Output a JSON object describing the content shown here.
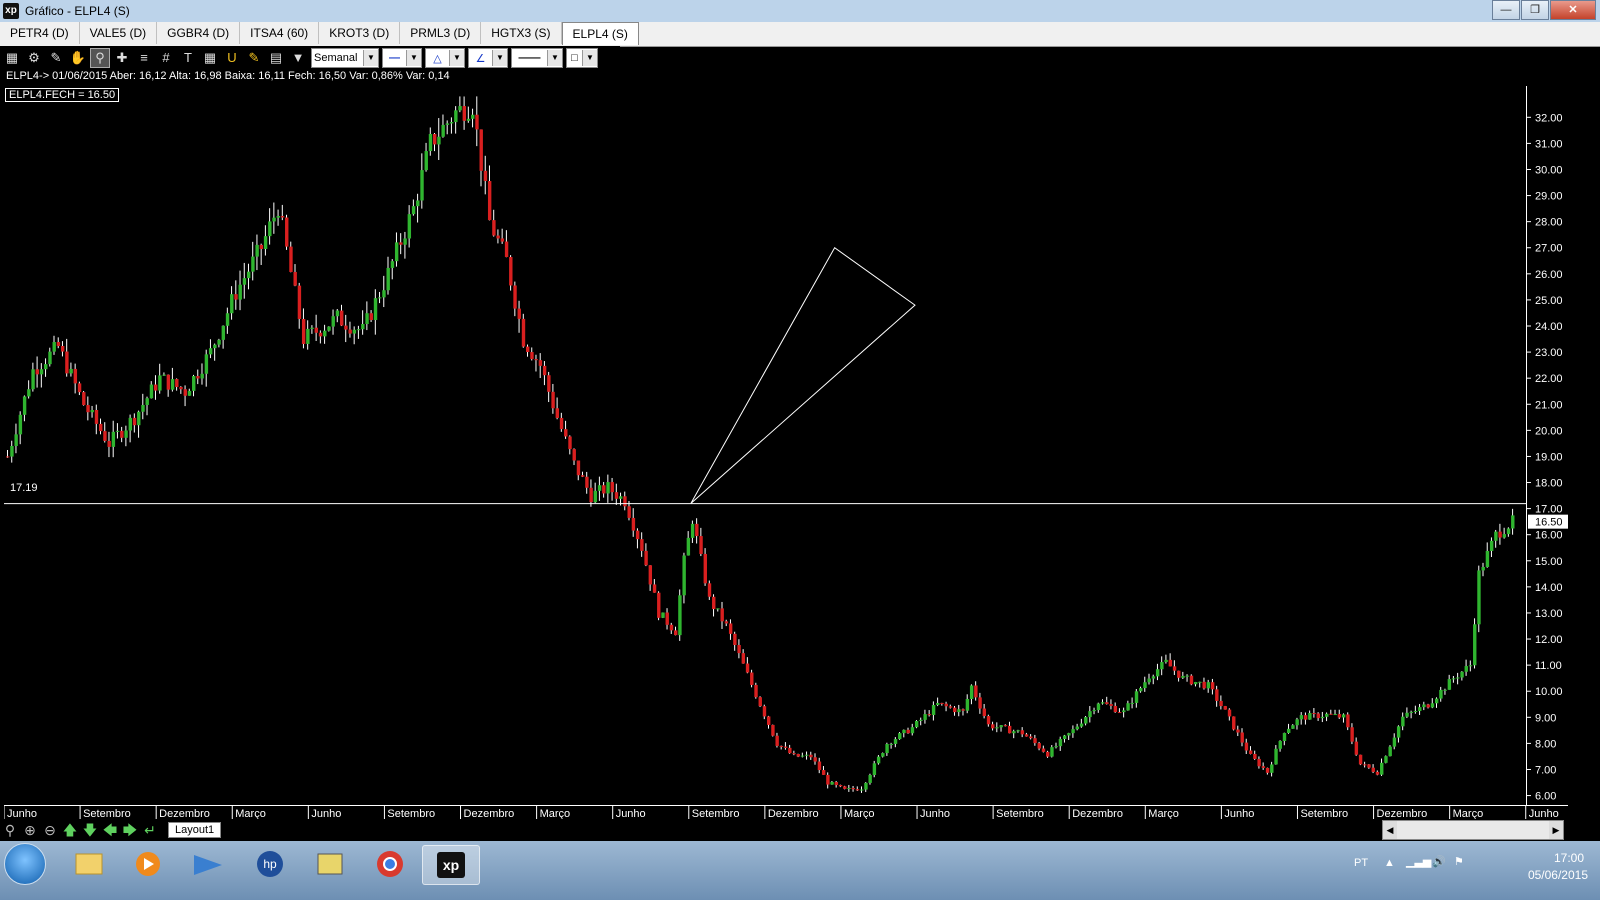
{
  "window": {
    "title": "Gráfico - ELPL4 (S)",
    "app_logo": "xp"
  },
  "tabs": [
    {
      "label": "PETR4 (D)"
    },
    {
      "label": "VALE5 (D)"
    },
    {
      "label": "GGBR4 (D)"
    },
    {
      "label": "ITSA4 (60)"
    },
    {
      "label": "KROT3 (D)"
    },
    {
      "label": "PRML3 (D)"
    },
    {
      "label": "HGTX3 (S)"
    },
    {
      "label": "ELPL4 (S)",
      "active": true
    }
  ],
  "toolbar": {
    "tools": [
      "chart-icon",
      "gear-icon",
      "pencil-icon",
      "hand-icon",
      "zoom-cursor-icon",
      "crosshair-icon",
      "fib-icon",
      "grid-icon",
      "text-icon",
      "calculator-icon",
      "magnet-icon",
      "brush-icon",
      "clipboard-icon",
      "filter-icon"
    ],
    "period": "Semanal"
  },
  "info_line": "ELPL4-> 01/06/2015 Aber: 16,12 Alta: 16,98 Baixa: 16,11 Fech: 16,50 Var: 0,86% Var: 0,14",
  "legend": "ELPL4.FECH = 16.50",
  "hline_label": "17.19",
  "last_price_label": "16.50",
  "bottom": {
    "layout_tab": "Layout1"
  },
  "taskbar": {
    "lang": "PT",
    "time": "17:00",
    "date": "05/06/2015"
  },
  "colors": {
    "up": "#2fb52f",
    "down": "#d91f1f",
    "background": "#000000",
    "axis": "#ffffff"
  },
  "chart_data": {
    "type": "candlestick",
    "symbol": "ELPL4",
    "interval": "Semanal",
    "ylim": [
      5.6,
      33.2
    ],
    "y_ticks": [
      "6.00",
      "7.00",
      "8.00",
      "9.00",
      "10.00",
      "11.00",
      "12.00",
      "13.00",
      "14.00",
      "15.00",
      "16.00",
      "17.00",
      "18.00",
      "19.00",
      "20.00",
      "21.00",
      "22.00",
      "23.00",
      "24.00",
      "25.00",
      "26.00",
      "27.00",
      "28.00",
      "29.00",
      "30.00",
      "31.00",
      "32.00"
    ],
    "x_labels": [
      "Junho",
      "Setembro",
      "Dezembro",
      "Março",
      "Junho",
      "Setembro",
      "Dezembro",
      "Março",
      "Junho",
      "Setembro",
      "Dezembro",
      "Março",
      "Junho",
      "Setembro",
      "Dezembro",
      "Março",
      "Junho",
      "Setembro",
      "Dezembro",
      "Março",
      "Junho"
    ],
    "close_path": [
      [
        0,
        19.0
      ],
      [
        6,
        22.3
      ],
      [
        12,
        23.2
      ],
      [
        18,
        21.0
      ],
      [
        24,
        19.5
      ],
      [
        30,
        20.5
      ],
      [
        36,
        22.0
      ],
      [
        42,
        21.5
      ],
      [
        48,
        23.0
      ],
      [
        54,
        25.3
      ],
      [
        60,
        27.0
      ],
      [
        64,
        28.6
      ],
      [
        70,
        23.5
      ],
      [
        78,
        24.3
      ],
      [
        84,
        23.8
      ],
      [
        90,
        26.0
      ],
      [
        96,
        28.5
      ],
      [
        100,
        31.0
      ],
      [
        106,
        32.2
      ],
      [
        110,
        32.5
      ],
      [
        114,
        28.0
      ],
      [
        118,
        26.5
      ],
      [
        122,
        23.5
      ],
      [
        126,
        22.5
      ],
      [
        130,
        20.5
      ],
      [
        134,
        18.7
      ],
      [
        138,
        17.5
      ],
      [
        142,
        17.8
      ],
      [
        146,
        17.3
      ],
      [
        150,
        15.5
      ],
      [
        154,
        13.0
      ],
      [
        158,
        12.3
      ],
      [
        160,
        15.0
      ],
      [
        162,
        16.6
      ],
      [
        166,
        13.5
      ],
      [
        170,
        12.5
      ],
      [
        174,
        11.0
      ],
      [
        178,
        9.5
      ],
      [
        182,
        8.0
      ],
      [
        186,
        7.5
      ],
      [
        190,
        7.5
      ],
      [
        194,
        6.5
      ],
      [
        198,
        6.2
      ],
      [
        202,
        6.3
      ],
      [
        208,
        8.0
      ],
      [
        214,
        8.6
      ],
      [
        220,
        9.5
      ],
      [
        226,
        9.2
      ],
      [
        228,
        10.2
      ],
      [
        232,
        8.7
      ],
      [
        240,
        8.4
      ],
      [
        246,
        7.6
      ],
      [
        252,
        8.5
      ],
      [
        258,
        9.6
      ],
      [
        264,
        9.2
      ],
      [
        270,
        10.6
      ],
      [
        274,
        11.1
      ],
      [
        278,
        10.5
      ],
      [
        284,
        10.2
      ],
      [
        288,
        9.2
      ],
      [
        294,
        7.5
      ],
      [
        298,
        6.9
      ],
      [
        302,
        8.5
      ],
      [
        306,
        9.0
      ],
      [
        312,
        9.1
      ],
      [
        316,
        9.0
      ],
      [
        320,
        7.2
      ],
      [
        324,
        6.9
      ],
      [
        330,
        9.0
      ],
      [
        336,
        9.5
      ],
      [
        342,
        10.5
      ],
      [
        346,
        11.0
      ],
      [
        348,
        14.5
      ],
      [
        352,
        16.0
      ],
      [
        356,
        16.5
      ]
    ],
    "annotations": [
      {
        "type": "horizontal-line",
        "value": 17.19,
        "label": "17.19"
      },
      {
        "type": "drawn-triangle",
        "points": [
          [
            162,
            17.2
          ],
          [
            196,
            27.0
          ],
          [
            215,
            24.8
          ]
        ]
      }
    ],
    "last_value": 16.5
  }
}
